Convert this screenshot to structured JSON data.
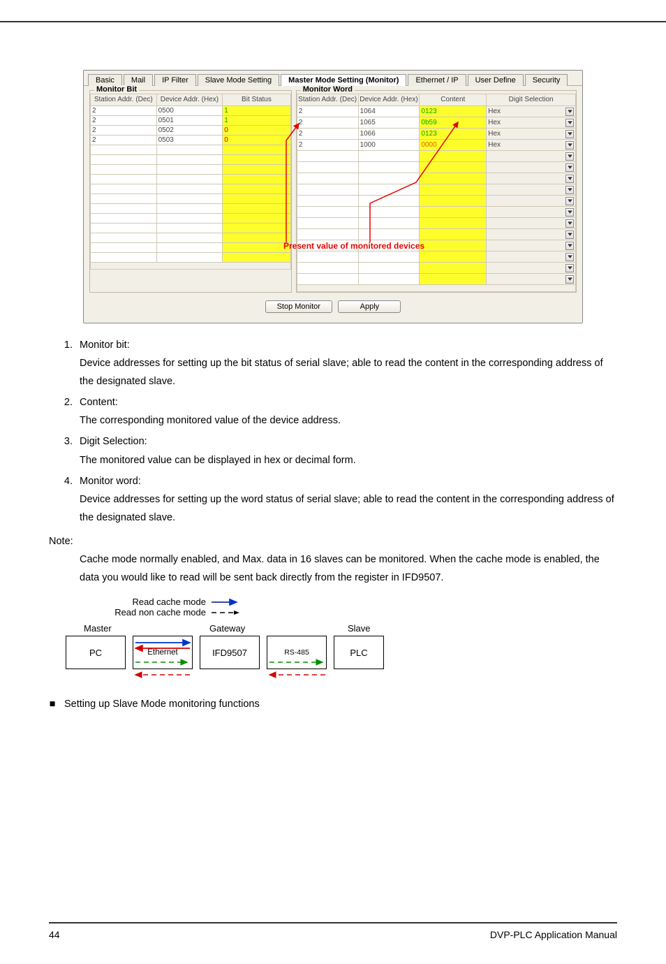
{
  "tabs": {
    "items": [
      "Basic",
      "Mail",
      "IP Filter",
      "Slave Mode Setting",
      "Master Mode Setting (Monitor)",
      "Ethernet / IP",
      "User Define",
      "Security"
    ],
    "active_index": 4
  },
  "monitor_bit": {
    "legend": "Monitor Bit",
    "headers": [
      "Station Addr. (Dec)",
      "Device Addr. (Hex)",
      "Bit Status"
    ],
    "rows": [
      {
        "station": "2",
        "device": "0500",
        "status": "1"
      },
      {
        "station": "2",
        "device": "0501",
        "status": "1"
      },
      {
        "station": "2",
        "device": "0502",
        "status": "0"
      },
      {
        "station": "2",
        "device": "0503",
        "status": "0"
      }
    ],
    "blank_rows": 12
  },
  "monitor_word": {
    "legend": "Monitor Word",
    "headers": [
      "Station Addr. (Dec)",
      "Device Addr. (Hex)",
      "Content",
      "Digit Selection"
    ],
    "rows": [
      {
        "station": "2",
        "device": "1064",
        "content": "0123",
        "content_color": "green",
        "digit": "Hex"
      },
      {
        "station": "2",
        "device": "1065",
        "content": "0b59",
        "content_color": "green",
        "digit": "Hex"
      },
      {
        "station": "2",
        "device": "1066",
        "content": "0123",
        "content_color": "green",
        "digit": "Hex"
      },
      {
        "station": "2",
        "device": "1000",
        "content": "0000",
        "content_color": "yellow",
        "digit": "Hex"
      }
    ],
    "blank_rows": 12
  },
  "annotation": "Present value of monitored devices",
  "buttons": {
    "stop": "Stop Monitor",
    "apply": "Apply"
  },
  "list": {
    "items": [
      {
        "num": "1.",
        "title": "Monitor bit:",
        "body": "Device addresses for setting up the bit status of serial slave; able to read the content in the corresponding address of the designated slave."
      },
      {
        "num": "2.",
        "title": "Content:",
        "body": "The corresponding monitored value of the device address."
      },
      {
        "num": "3.",
        "title": "Digit Selection:",
        "body": "The monitored value can be displayed in hex or decimal form."
      },
      {
        "num": "4.",
        "title": "Monitor word:",
        "body": "Device addresses for setting up the word status of serial slave; able to read the content in the corresponding address of the designated slave."
      }
    ]
  },
  "note": {
    "label": "Note:",
    "body": "Cache mode normally enabled, and Max. data in 16 slaves can be monitored. When the cache mode is enabled, the data you would like to read will be sent back directly from the register in IFD9507."
  },
  "diagram": {
    "legend_cache": "Read cache mode",
    "legend_noncache": "Read non cache mode",
    "master": "Master",
    "gateway": "Gateway",
    "slave": "Slave",
    "pc": "PC",
    "ifd": "IFD9507",
    "plc": "PLC",
    "ethernet": "Ethernet",
    "rs485": "RS-485"
  },
  "bullet": "Setting up Slave Mode monitoring functions",
  "footer": {
    "page": "44",
    "title": "DVP-PLC  Application  Manual"
  }
}
